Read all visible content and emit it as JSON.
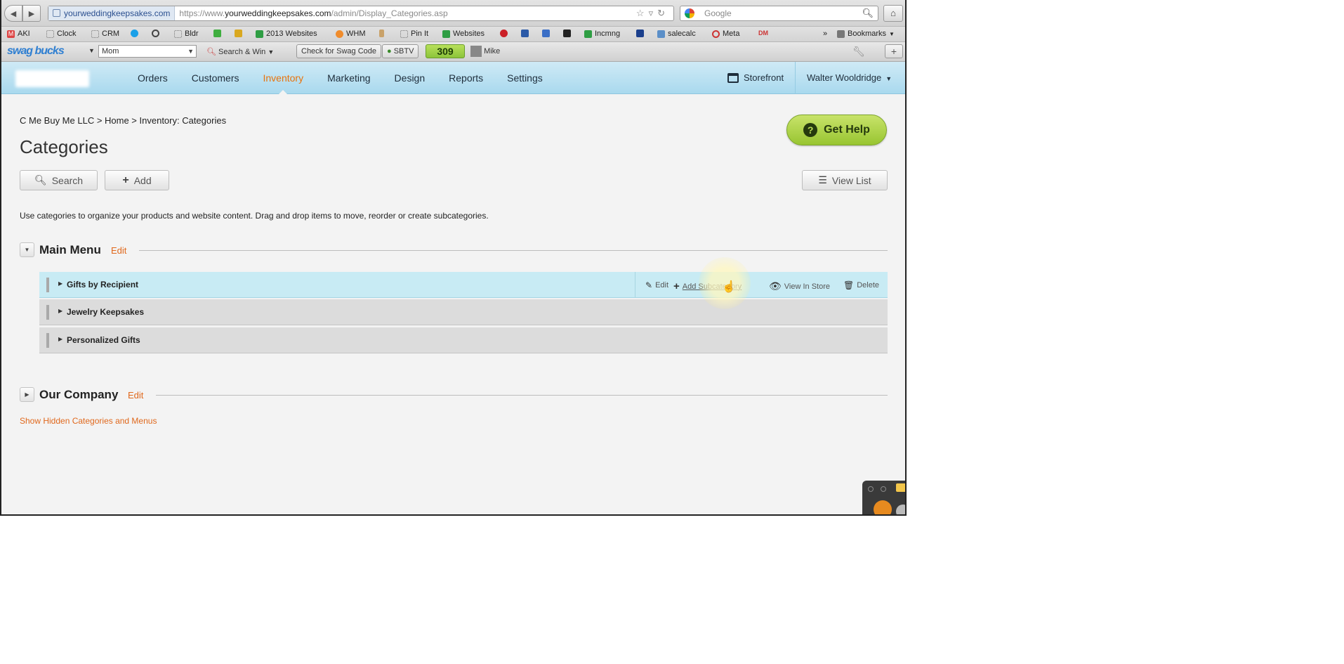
{
  "browser": {
    "site_identity": "yourweddingkeepsakes.com",
    "url_prefix": "https://www.",
    "url_domain": "yourweddingkeepsakes.com",
    "url_path": "/admin/Display_Categories.asp",
    "search_placeholder": "Google"
  },
  "bookmarks": {
    "items": [
      "AKI",
      "Clock",
      "CRM",
      "Bldr",
      "2013 Websites",
      "WHM",
      "Pin It",
      "Websites",
      "Incmng",
      "salecalc",
      "Meta",
      "DM"
    ],
    "overflow": "»",
    "bookmarks_menu": "Bookmarks"
  },
  "swagbucks": {
    "logo_left": "swag",
    "logo_right": "bucks",
    "select_value": "Mom",
    "search_win": "Search & Win",
    "check_code": "Check for Swag Code",
    "sbtv": "SBTV",
    "count": "309",
    "user": "Mike"
  },
  "nav": {
    "items": [
      "Orders",
      "Customers",
      "Inventory",
      "Marketing",
      "Design",
      "Reports",
      "Settings"
    ],
    "active": "Inventory",
    "storefront": "Storefront",
    "user": "Walter Wooldridge"
  },
  "page": {
    "breadcrumb": "C Me Buy Me LLC > Home > Inventory: Categories",
    "title": "Categories",
    "get_help": "Get Help",
    "search_btn": "Search",
    "add_btn": "Add",
    "view_list_btn": "View List",
    "intro": "Use categories to organize your products and website content. Drag and drop items to move, reorder or create subcategories.",
    "show_hidden": "Show Hidden Categories and Menus"
  },
  "menus": [
    {
      "title": "Main Menu",
      "edit": "Edit",
      "categories": [
        "Gifts by Recipient",
        "Jewelry Keepsakes",
        "Personalized Gifts"
      ]
    },
    {
      "title": "Our Company",
      "edit": "Edit",
      "categories": []
    }
  ],
  "row_actions": {
    "edit": "Edit",
    "add_subcategory": "Add Subcategory",
    "view_in_store": "View In Store",
    "delete": "Delete"
  },
  "colors": {
    "accent_orange": "#e0681c",
    "header_blue": "#a9d9ee",
    "help_green": "#98c531"
  }
}
